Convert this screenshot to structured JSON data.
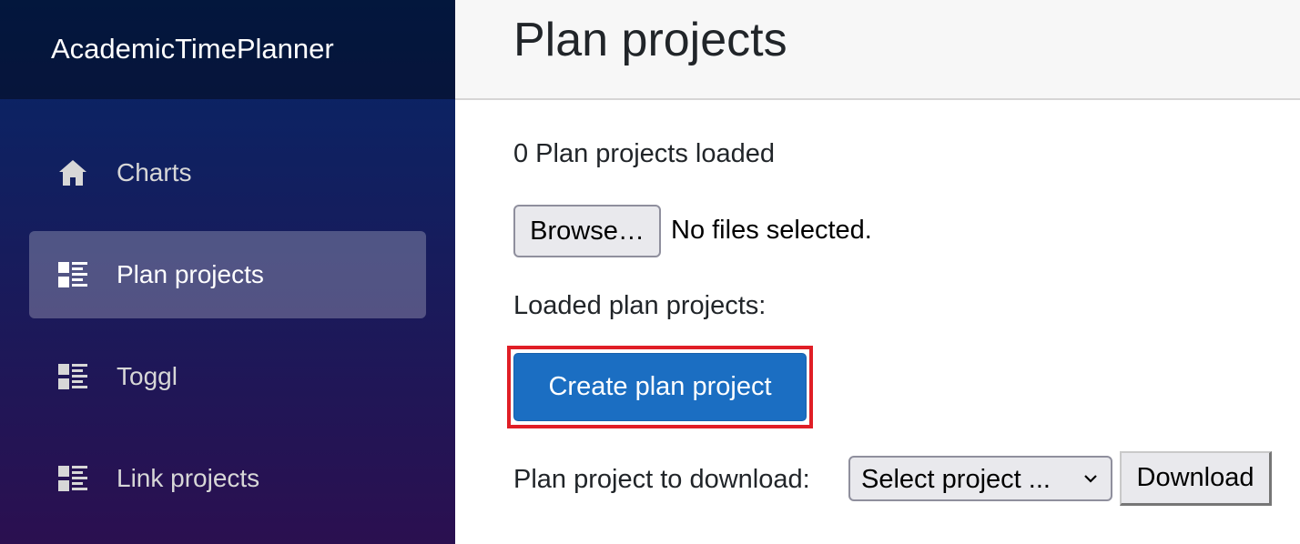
{
  "app": {
    "brand": "AcademicTimePlanner"
  },
  "sidebar": {
    "items": [
      {
        "label": "Charts",
        "icon": "home-icon",
        "active": false
      },
      {
        "label": "Plan projects",
        "icon": "list-icon",
        "active": true
      },
      {
        "label": "Toggl",
        "icon": "list-icon",
        "active": false
      },
      {
        "label": "Link projects",
        "icon": "list-icon",
        "active": false
      }
    ]
  },
  "header": {
    "title": "Plan projects"
  },
  "main": {
    "loaded_count_text": "0 Plan projects loaded",
    "file_input": {
      "button_label": "Browse…",
      "status": "No files selected."
    },
    "loaded_label": "Loaded plan projects:",
    "create_button_label": "Create plan project",
    "download": {
      "label": "Plan project to download:",
      "select_value": "Select project ...",
      "button_label": "Download"
    }
  },
  "colors": {
    "sidebar_top": "#052767",
    "sidebar_bottom": "#3a0647",
    "primary": "#1b6ec2",
    "highlight": "#e01e26"
  }
}
